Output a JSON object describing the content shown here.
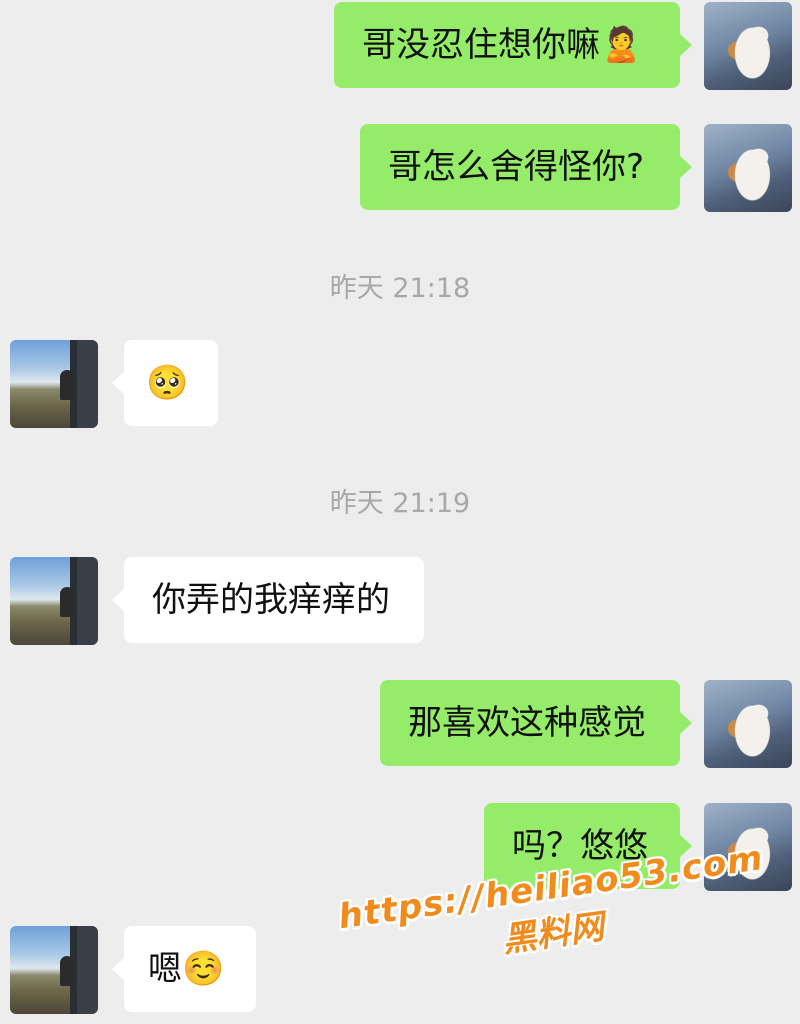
{
  "messages": [
    {
      "side": "me",
      "text": "哥没忍住想你嘛",
      "emoji": "🙎"
    },
    {
      "side": "me",
      "text": "哥怎么舍得怪你?"
    },
    {
      "type": "time",
      "text": "昨天 21:18"
    },
    {
      "side": "them",
      "emoji": "🥺"
    },
    {
      "type": "time",
      "text": "昨天 21:19"
    },
    {
      "side": "them",
      "text": "你弄的我痒痒的"
    },
    {
      "side": "me",
      "text": "那喜欢这种感觉"
    },
    {
      "side": "me",
      "text": "吗？悠悠"
    },
    {
      "side": "them",
      "text": "嗯",
      "emoji": "☺️"
    }
  ],
  "watermark": {
    "url": "https://heiliao53.com",
    "name": "黑料网"
  },
  "colors": {
    "background": "#ededed",
    "self_bubble": "#95ec69",
    "other_bubble": "#ffffff",
    "watermark": "#f08b1c"
  }
}
